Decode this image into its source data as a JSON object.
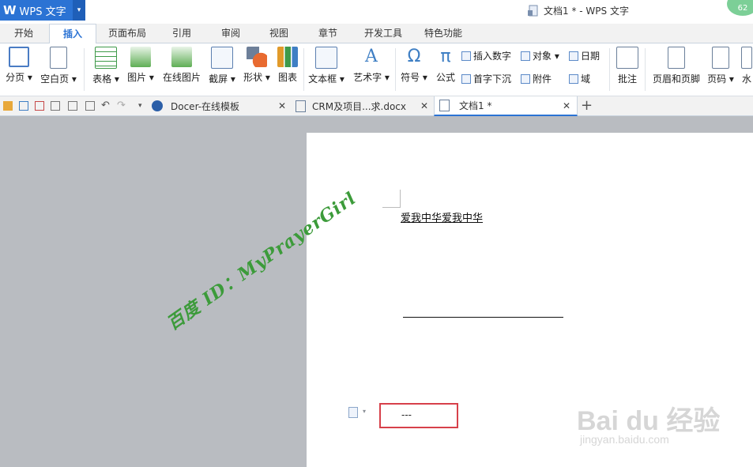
{
  "app": {
    "logo": "W",
    "name": "WPS 文字",
    "window_title": "文档1 * - WPS 文字",
    "badge": "62"
  },
  "menu_tabs": [
    "开始",
    "插入",
    "页面布局",
    "引用",
    "审阅",
    "视图",
    "章节",
    "开发工具",
    "特色功能"
  ],
  "ribbon": {
    "page_break": "分页 ▾",
    "blank_page": "空白页 ▾",
    "table": "表格 ▾",
    "picture": "图片 ▾",
    "online_picture": "在线图片",
    "screenshot": "截屏 ▾",
    "shape": "形状 ▾",
    "chart": "图表",
    "textbox": "文本框 ▾",
    "wordart": "艺术字 ▾",
    "symbol": "符号 ▾",
    "formula": "公式",
    "insert_number": "插入数字",
    "drop_cap": "首字下沉",
    "object": "对象 ▾",
    "attachment": "附件",
    "date": "日期",
    "field": "域",
    "comment": "批注",
    "header_footer": "页眉和页脚",
    "page_number": "页码 ▾",
    "watermark": "水"
  },
  "doc_tabs": {
    "docer": "Docer-在线模板",
    "crm": "CRM及项目...求.docx",
    "doc1": "文档1 *"
  },
  "document": {
    "underlined_text": "爱我中华爱我中华",
    "box_text": "---"
  },
  "watermarks": {
    "green": "百度 ID：MyPrayerGirl",
    "baidu": "Bai du 经验",
    "url": "jingyan.baidu.com"
  },
  "colors": {
    "accent": "#2b73d4",
    "red_box": "#d7404a",
    "green_watermark": "#3c9b3a"
  }
}
